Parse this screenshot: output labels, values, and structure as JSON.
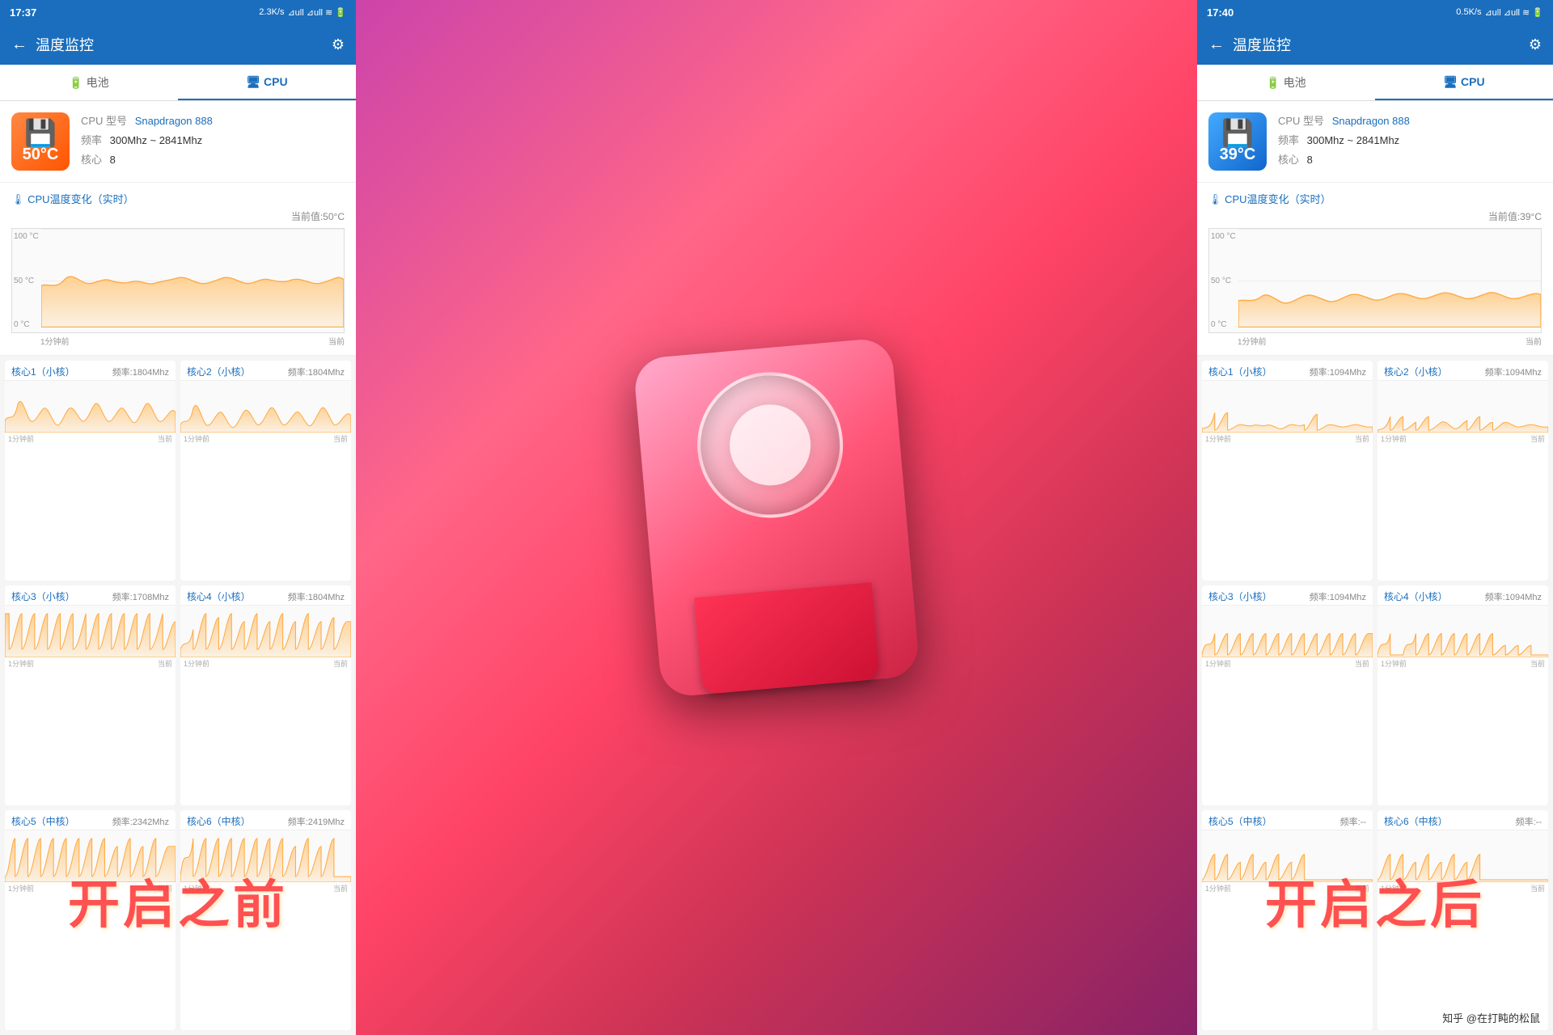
{
  "left_panel": {
    "status": {
      "time": "17:37",
      "speed": "2.3K/s",
      "icons": "📶"
    },
    "header": {
      "back": "←",
      "title": "温度监控",
      "gear": "⚙"
    },
    "tabs": [
      {
        "label": "🔋 电池",
        "active": false
      },
      {
        "label": "🖥 CPU",
        "active": true
      }
    ],
    "cpu": {
      "temp": "50°C",
      "model_label": "CPU 型号",
      "model_value": "Snapdragon 888",
      "freq_label": "频率",
      "freq_value": "300Mhz ~ 2841Mhz",
      "cores_label": "核心",
      "cores_value": "8"
    },
    "chart": {
      "title": "🌡 CPU温度变化（实时）",
      "current": "当前值:50°C",
      "y_labels": [
        "100 °C",
        "50 °C",
        "0 °C"
      ],
      "time_labels": [
        "1分钟前",
        "当前"
      ]
    },
    "cores": [
      {
        "name": "核心1（小核）",
        "type": "small",
        "freq": "频率:1804Mhz",
        "time_start": "1分钟前",
        "time_end": "当前"
      },
      {
        "name": "核心2（小核）",
        "type": "small",
        "freq": "频率:1804Mhz",
        "time_start": "1分钟前",
        "time_end": "当前"
      },
      {
        "name": "核心3（小核）",
        "type": "small",
        "freq": "频率:1708Mhz",
        "time_start": "1分钟前",
        "time_end": "当前"
      },
      {
        "name": "核心4（小核）",
        "type": "small",
        "freq": "频率:1804Mhz",
        "time_start": "1分钟前",
        "time_end": "当前"
      },
      {
        "name": "核心5（中核）",
        "type": "mid",
        "freq": "频率:2342Mhz",
        "time_start": "1分钟前",
        "time_end": "当前"
      },
      {
        "name": "核心6（中核）",
        "type": "mid",
        "freq": "频率:2419Mhz",
        "time_start": "1分钟前",
        "time_end": "当前"
      }
    ],
    "overlay": "开启之前"
  },
  "right_panel": {
    "status": {
      "time": "17:40",
      "speed": "0.5K/s",
      "icons": "📶"
    },
    "header": {
      "back": "←",
      "title": "温度监控",
      "gear": "⚙"
    },
    "tabs": [
      {
        "label": "🔋 电池",
        "active": false
      },
      {
        "label": "🖥 CPU",
        "active": true
      }
    ],
    "cpu": {
      "temp": "39°C",
      "model_label": "CPU 型号",
      "model_value": "Snapdragon 888",
      "freq_label": "频率",
      "freq_value": "300Mhz ~ 2841Mhz",
      "cores_label": "核心",
      "cores_value": "8"
    },
    "chart": {
      "title": "🌡 CPU温度变化（实时）",
      "current": "当前值:39°C",
      "y_labels": [
        "100 °C",
        "50 °C",
        "0 °C"
      ],
      "time_labels": [
        "1分钟前",
        "当前"
      ]
    },
    "cores": [
      {
        "name": "核心1（小核）",
        "type": "small",
        "freq": "频率:1094Mhz",
        "time_start": "1分钟前",
        "time_end": "当前"
      },
      {
        "name": "核心2（小核）",
        "type": "small",
        "freq": "频率:1094Mhz",
        "time_start": "1分钟前",
        "time_end": "当前"
      },
      {
        "name": "核心3（小核）",
        "type": "small",
        "freq": "频率:1094Mhz",
        "time_start": "1分钟前",
        "time_end": "当前"
      },
      {
        "name": "核心4（小核）",
        "type": "small",
        "freq": "频率:1094Mhz",
        "time_start": "1分钟前",
        "time_end": "当前"
      },
      {
        "name": "核心5（中核）",
        "type": "mid",
        "freq": "频率:--",
        "time_start": "1分钟前",
        "time_end": "当前"
      },
      {
        "name": "核心6（中核）",
        "type": "mid",
        "freq": "频率:--",
        "time_start": "1分钟前",
        "time_end": "当前"
      }
    ],
    "overlay": "开启之后"
  },
  "watermark": "知乎 @在打盹的松鼠"
}
